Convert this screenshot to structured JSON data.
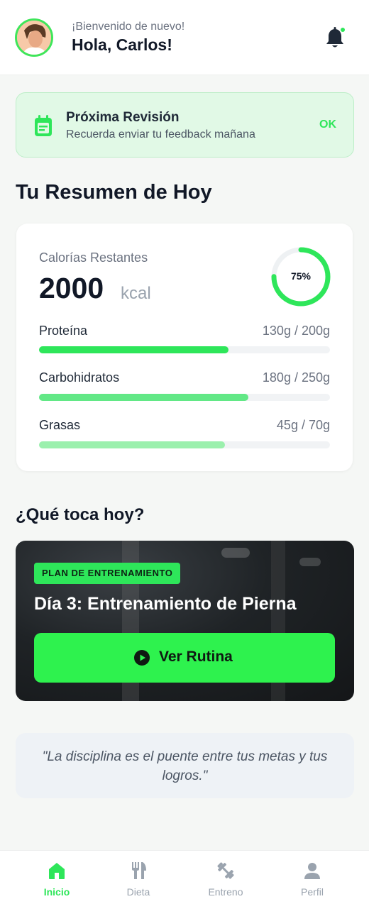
{
  "header": {
    "greeting_sub": "¡Bienvenido de nuevo!",
    "greeting_title": "Hola, Carlos!",
    "notification_dot": true
  },
  "reminder": {
    "title": "Próxima Revisión",
    "text": "Recuerda enviar tu feedback mañana",
    "ok_label": "OK"
  },
  "summary": {
    "section_title": "Tu Resumen de Hoy",
    "calories_label": "Calorías Restantes",
    "calories_value": "2000",
    "calories_unit": "kcal",
    "progress_percent": 75,
    "progress_label": "75%",
    "macros": [
      {
        "name": "Proteína",
        "value": "130g / 200g",
        "fraction": 0.65,
        "color": "#2ee65a"
      },
      {
        "name": "Carbohidratos",
        "value": "180g / 250g",
        "fraction": 0.72,
        "color": "#62e886"
      },
      {
        "name": "Grasas",
        "value": "45g / 70g",
        "fraction": 0.64,
        "color": "#9bf0ad"
      }
    ]
  },
  "today": {
    "section_title": "¿Qué toca hoy?",
    "badge": "PLAN DE ENTRENAMIENTO",
    "title": "Día 3: Entrenamiento de Pierna",
    "button_label": "Ver Rutina"
  },
  "quote": {
    "text": "\"La disciplina es el puente entre tus metas y tus logros.\""
  },
  "tabs": [
    {
      "label": "Inicio",
      "icon": "home-icon",
      "active": true
    },
    {
      "label": "Dieta",
      "icon": "fork-knife-icon",
      "active": false
    },
    {
      "label": "Entreno",
      "icon": "dumbbell-icon",
      "active": false
    },
    {
      "label": "Perfil",
      "icon": "user-icon",
      "active": false
    }
  ],
  "colors": {
    "accent": "#2ee65a",
    "button": "#2ef24e",
    "text_dark": "#111827",
    "muted": "#6b7280"
  }
}
